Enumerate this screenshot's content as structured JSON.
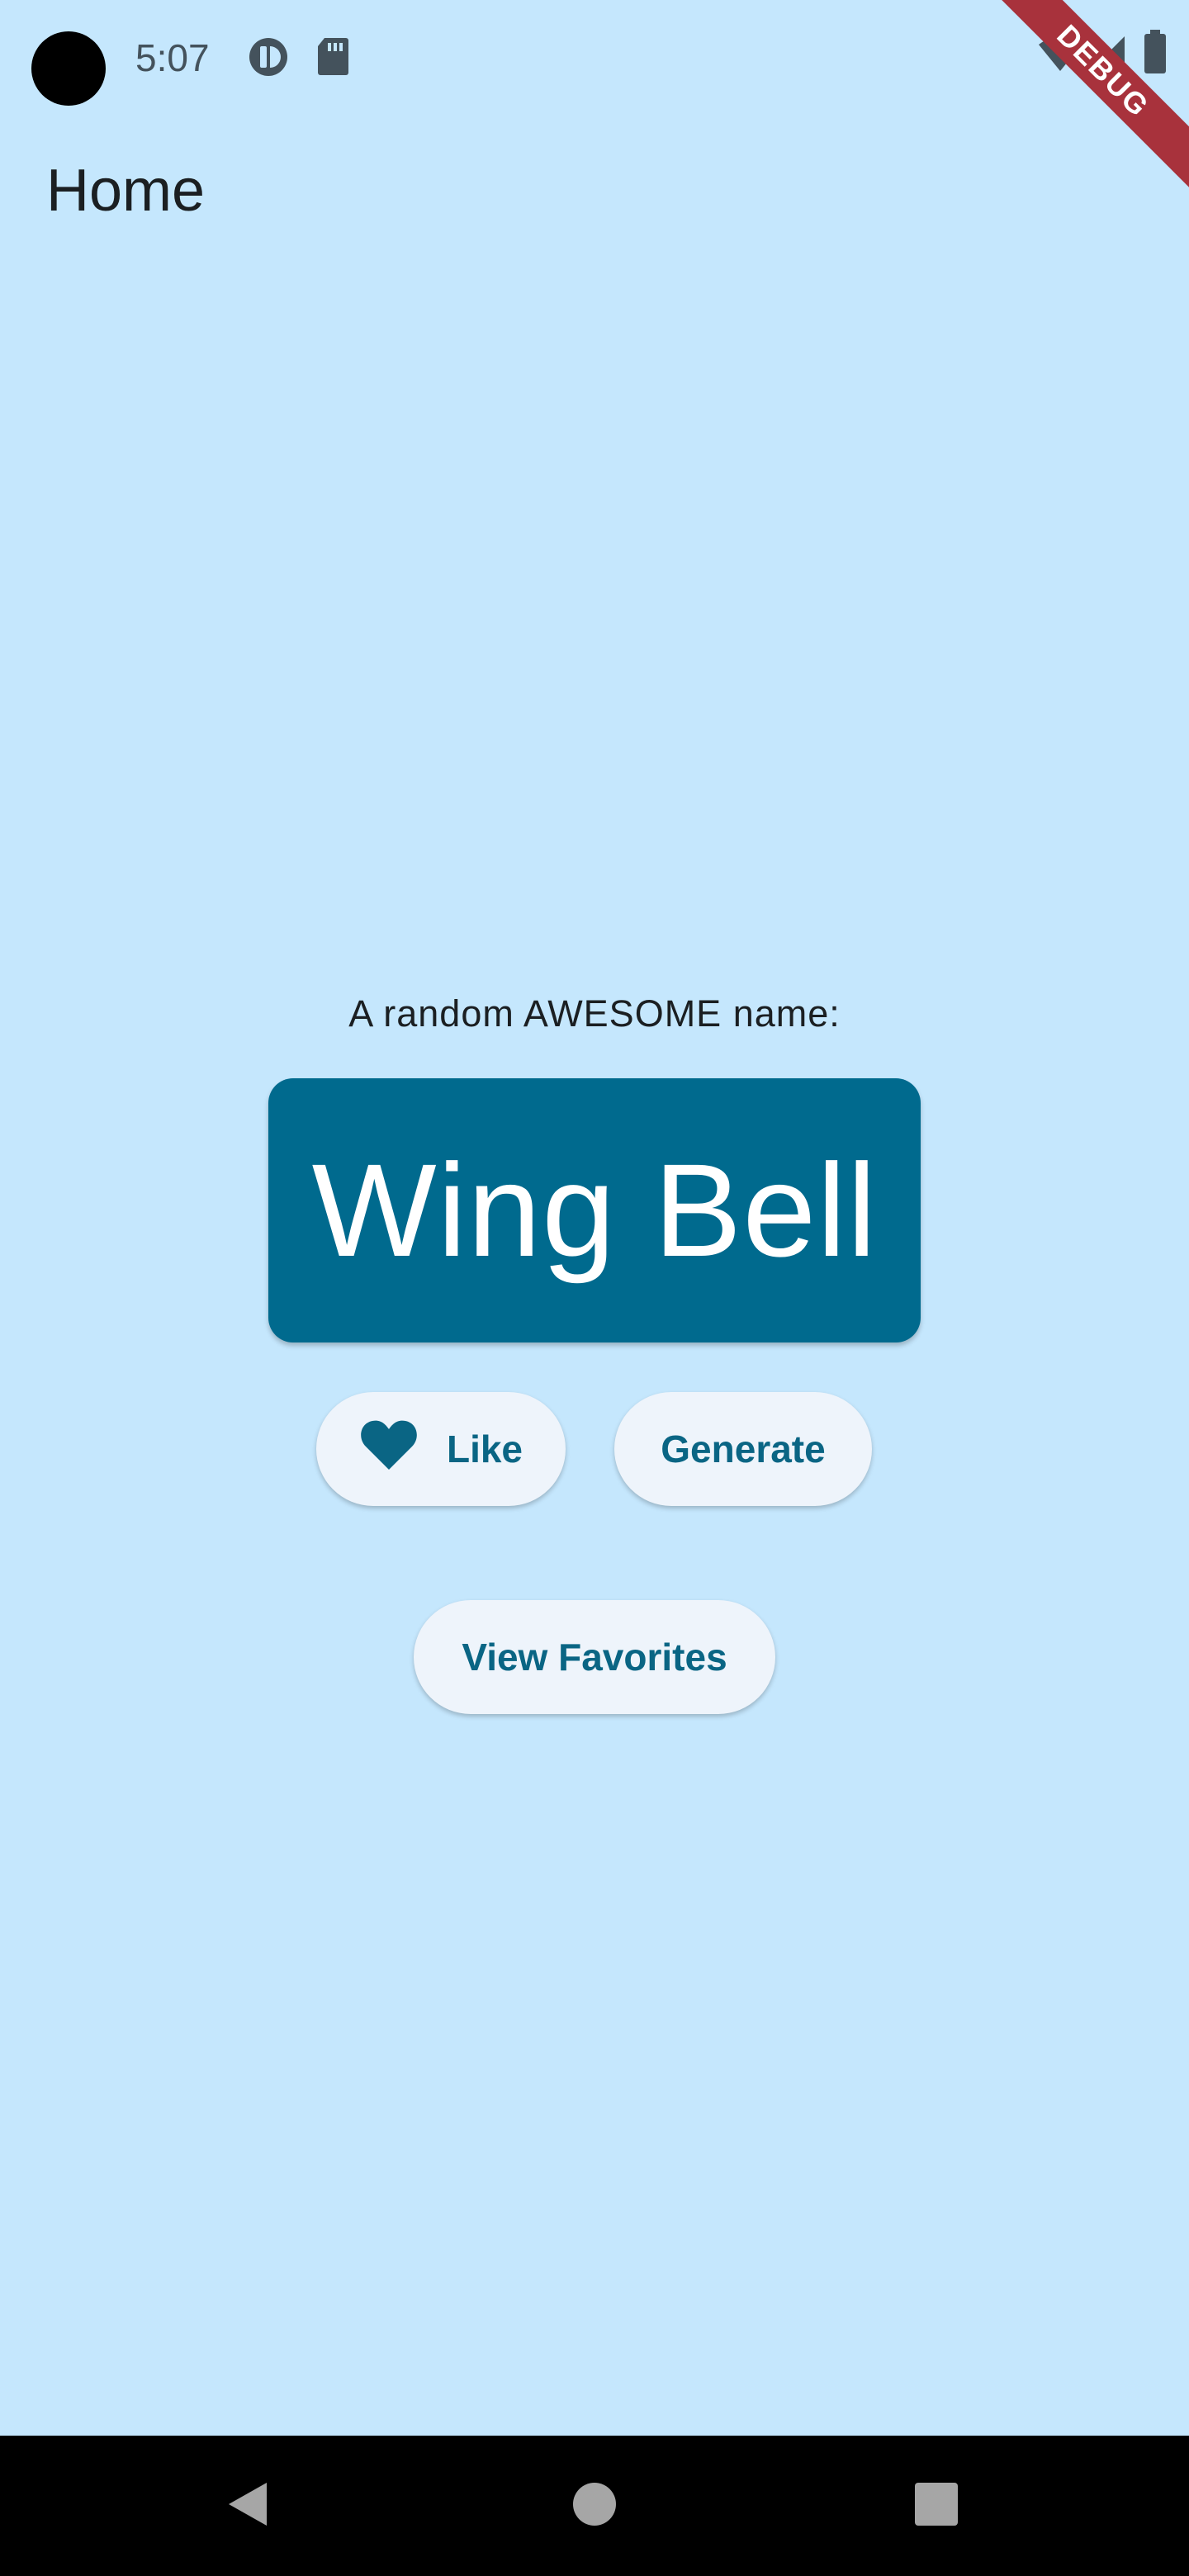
{
  "status_bar": {
    "time": "5:07",
    "icons": [
      "camera-cutout",
      "data-saver-icon",
      "sd-card-icon",
      "wifi-icon",
      "signal-icon",
      "battery-icon"
    ]
  },
  "debug_banner": "DEBUG",
  "app_bar": {
    "title": "Home"
  },
  "main": {
    "caption": "A random AWESOME name:",
    "generated_name": "Wing Bell",
    "like_label": "Like",
    "generate_label": "Generate",
    "view_favorites_label": "View Favorites"
  },
  "colors": {
    "background": "#c5e7fd",
    "card": "#006a8e",
    "accent_text": "#0a6584",
    "button_bg": "#eef4fb",
    "debug_ribbon": "#a8323c"
  },
  "nav_bar": {
    "buttons": [
      "back-icon",
      "home-icon",
      "recents-icon"
    ]
  }
}
